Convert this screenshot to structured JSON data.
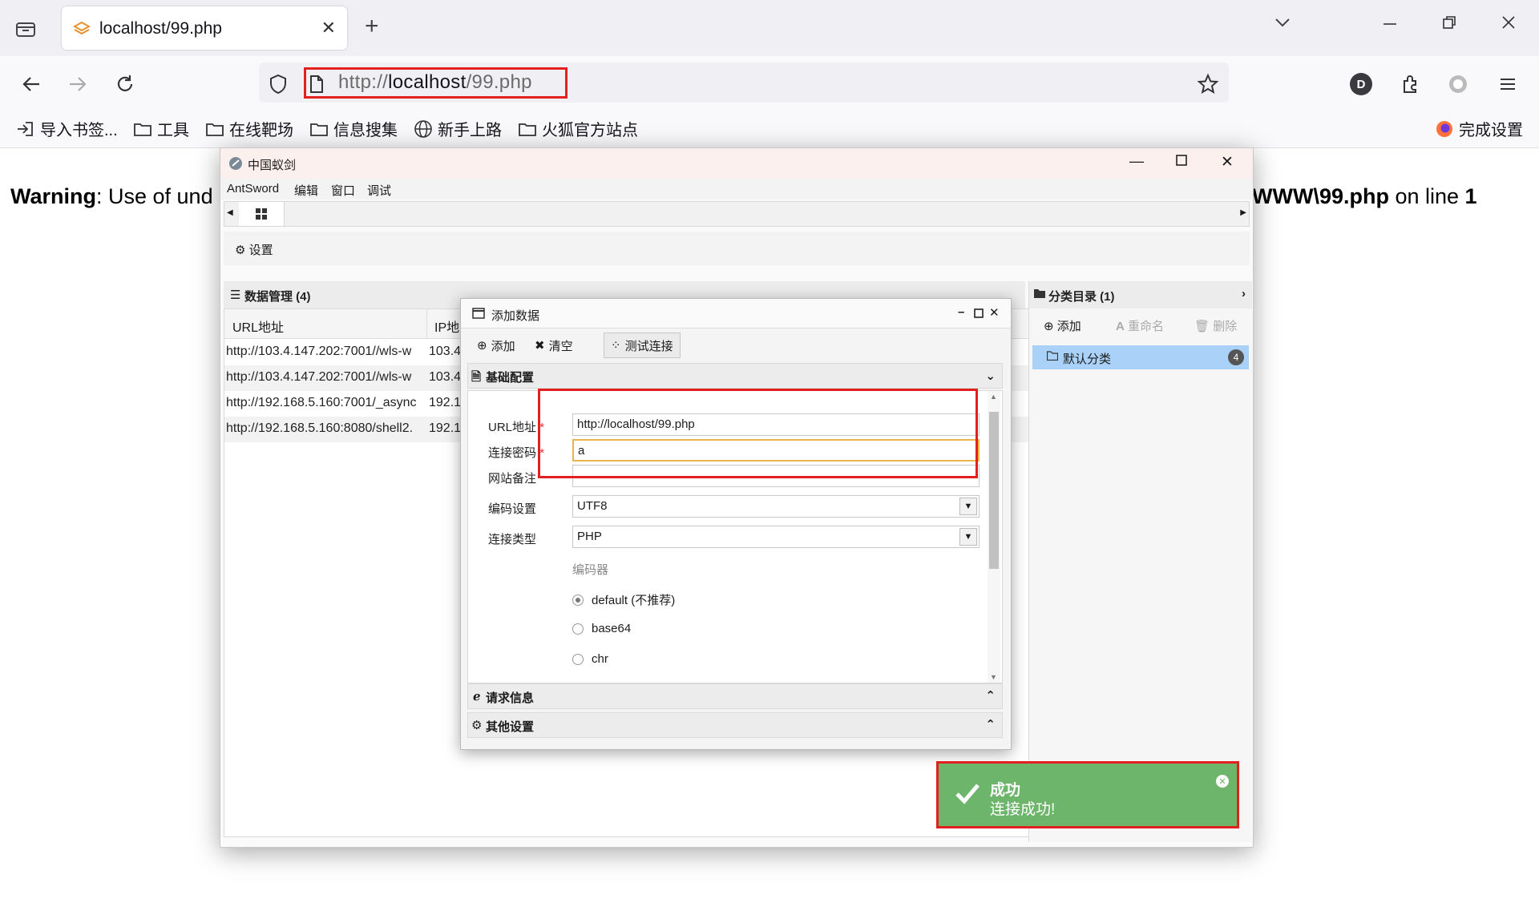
{
  "browser": {
    "tab_title": "localhost/99.php",
    "url_prefix": "http://",
    "url_host": "localhost",
    "url_path": "/99.php",
    "bookmarks": [
      "导入书签...",
      "工具",
      "在线靶场",
      "信息搜集",
      "新手上路",
      "火狐官方站点"
    ],
    "setup_label": "完成设置",
    "profile_initial": "D"
  },
  "page": {
    "warning_bold": "Warning",
    "warning_left": ": Use of und",
    "warning_file": "WWW\\99.php",
    "warning_on_line": " on line ",
    "warning_line_no": "1"
  },
  "antsword": {
    "window_title": "中国蚁剑",
    "menu": [
      "AntSword",
      "编辑",
      "窗口",
      "调试"
    ],
    "settings_label": "设置",
    "data_panel_title": "数据管理 (4)",
    "columns": [
      "URL地址",
      "IP地"
    ],
    "rows": [
      {
        "url": "http://103.4.147.202:7001//wls-w",
        "ip": "103.4"
      },
      {
        "url": "http://103.4.147.202:7001//wls-w",
        "ip": "103.4"
      },
      {
        "url": "http://192.168.5.160:7001/_async",
        "ip": "192.1"
      },
      {
        "url": "http://192.168.5.160:8080/shell2.",
        "ip": "192.1"
      }
    ],
    "category_panel_title": "分类目录 (1)",
    "category_actions": [
      "添加",
      "重命名",
      "删除"
    ],
    "default_category": "默认分类",
    "default_category_count": "4"
  },
  "dialog": {
    "title": "添加数据",
    "buttons": [
      "添加",
      "清空",
      "测试连接"
    ],
    "basic_section": "基础配置",
    "fields": {
      "url_label": "URL地址",
      "url_value": "http://localhost/99.php",
      "password_label": "连接密码",
      "password_value": "a",
      "note_label": "网站备注",
      "note_value": "",
      "encoding_label": "编码设置",
      "encoding_value": "UTF8",
      "type_label": "连接类型",
      "type_value": "PHP"
    },
    "required_mark": "*",
    "encoder_label": "编码器",
    "encoders": [
      {
        "label": "default (不推荐)",
        "selected": true
      },
      {
        "label": "base64",
        "selected": false
      },
      {
        "label": "chr",
        "selected": false
      }
    ],
    "request_section": "请求信息",
    "other_section": "其他设置"
  },
  "toast": {
    "title": "成功",
    "message": "连接成功!",
    "color": "#6cb56a"
  },
  "colors": {
    "highlight": "#e32020",
    "selected_category": "#aad1f7"
  }
}
